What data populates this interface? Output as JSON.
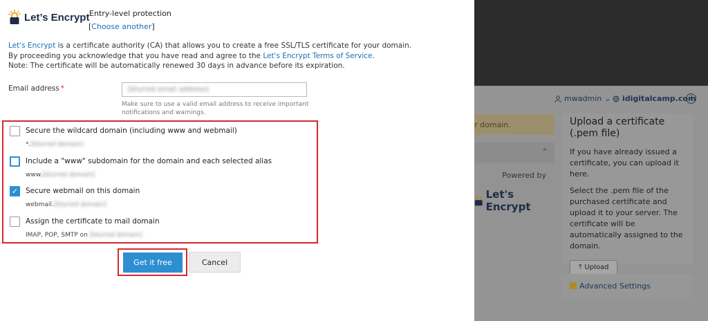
{
  "brand": {
    "name": "Let’s Encrypt",
    "icon": "lets-encrypt-lock-icon"
  },
  "header": {
    "title": "Entry-level protection",
    "choose_prefix": "[",
    "choose_link": "Choose another",
    "choose_suffix": "]"
  },
  "intro": {
    "line1_link": "Let's Encrypt",
    "line1_text": " is a certificate authority (CA) that allows you to create a free SSL/TLS certificate for your domain.",
    "line2_text": "By proceeding you acknowledge that you have read and agree to the ",
    "line2_link": "Let's Encrypt Terms of Service",
    "line2_suffix": ".",
    "line3_text": "Note: The certificate will be automatically renewed 30 days in advance before its expiration."
  },
  "email": {
    "label": "Email address",
    "required_mark": "*",
    "value": "[blurred email address]",
    "hint_line1": "Make sure to use a valid email address to receive important",
    "hint_line2": "notifications and warnings."
  },
  "options": [
    {
      "label": "Secure the wildcard domain (including www and webmail)",
      "sub_prefix": "*.",
      "sub_blur": "[blurred domain]",
      "checked": false
    },
    {
      "label": "Include a \"www\" subdomain for the domain and each selected alias",
      "sub_prefix": "www.",
      "sub_blur": "[blurred domain]",
      "checked": false
    },
    {
      "label": "Secure webmail on this domain",
      "sub_prefix": "webmail.",
      "sub_blur": "[blurred domain]",
      "checked": true
    },
    {
      "label": "Assign the certificate to mail domain",
      "sub_prefix": "IMAP, POP, SMTP on ",
      "sub_blur": "[blurred domain]",
      "checked": false
    }
  ],
  "buttons": {
    "primary": "Get it free",
    "cancel": "Cancel"
  },
  "background": {
    "user": "mwadmin",
    "site": "idigitalcamp.com",
    "help": "?",
    "warning_fragment": "r domain.",
    "powered_by": "Powered by",
    "powered_brand": "Let's Encrypt",
    "upload_card": {
      "title": "Upload a certificate (.pem file)",
      "p1": "If you have already issued a certificate, you can upload it here.",
      "p2": "Select the .pem file of the purchased certificate and upload it to your server. The certificate will be automatically assigned to the domain.",
      "button": "Upload"
    },
    "advanced": "Advanced Settings"
  },
  "colors": {
    "accent": "#2d8fd1",
    "highlight_border": "#d8262e",
    "link": "#1a6fb5"
  }
}
